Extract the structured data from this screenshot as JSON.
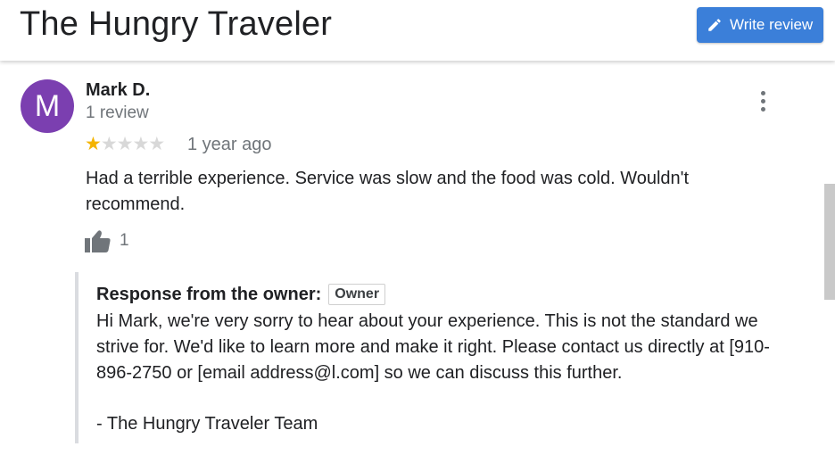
{
  "header": {
    "title": "The Hungry Traveler",
    "write_review_label": "Write review",
    "write_review_icon": "pencil-icon",
    "accent_color": "#3b7fd9"
  },
  "review": {
    "avatar_letter": "M",
    "avatar_color": "#7b3fb0",
    "reviewer_name": "Mark D.",
    "reviewer_review_count": "1 review",
    "rating": 1,
    "rating_max": 5,
    "date": "1 year ago",
    "text": "Had a terrible experience. Service was slow and the food was cold. Wouldn't recommend.",
    "like_icon": "thumbs-up-icon",
    "like_count": "1",
    "menu_icon": "more-vert-icon"
  },
  "owner_response": {
    "title": "Response from the owner:",
    "badge": "Owner",
    "body": "Hi Mark, we're very sorry to hear about your experience. This is not the standard we strive for. We'd like to learn more and make it right. Please contact us directly at [910-896-2750 or [email address@l.com] so we can discuss this further.",
    "signature": "- The Hungry Traveler Team"
  }
}
